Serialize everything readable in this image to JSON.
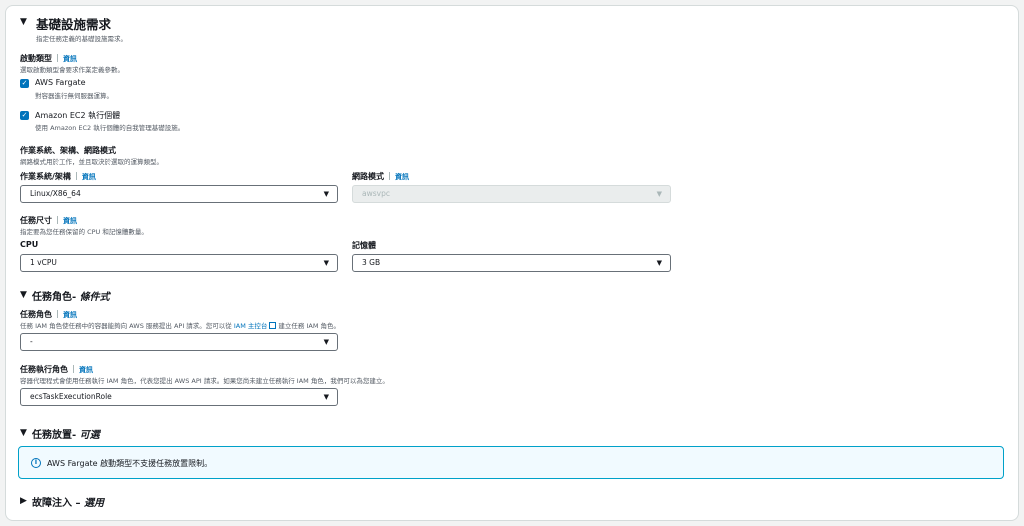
{
  "section": {
    "title": "基礎設施需求",
    "description": "指定任務定義的基礎設施需求。"
  },
  "launch_type": {
    "label": "啟動類型",
    "info": "資訊",
    "description": "選取啟動類型會要求作業定義參數。",
    "options": [
      {
        "title": "AWS Fargate",
        "description": "對容器進行無伺服器運算。",
        "checked": true
      },
      {
        "title": "Amazon EC2 執行個體",
        "description": "使用 Amazon EC2 執行個體的自我管理基礎設施。",
        "checked": true
      }
    ]
  },
  "os_arch_network": {
    "label": "作業系統、架構、網路模式",
    "description": "網路模式用於工作，並且取決於選取的運算類型。"
  },
  "os_arch": {
    "label": "作業系統/架構",
    "info": "資訊",
    "value": "Linux/X86_64"
  },
  "network_mode": {
    "label": "網路模式",
    "info": "資訊",
    "value": "awsvpc"
  },
  "task_size": {
    "label": "任務尺寸",
    "info": "資訊",
    "description": "指定要為您任務保留的 CPU 和記憶體數量。"
  },
  "cpu": {
    "label": "CPU",
    "value": "1 vCPU"
  },
  "memory": {
    "label": "記憶體",
    "value": "3 GB"
  },
  "task_role_section": {
    "title": "任務角色-",
    "suffix": "條件式"
  },
  "task_role": {
    "label": "任務角色",
    "info": "資訊",
    "description_pre": "任務 IAM 角色使任務中的容器能夠向 AWS 服務提出 API 請求。您可以從",
    "description_link": "IAM 主控台",
    "description_post": "建立任務 IAM 角色。",
    "value": "-"
  },
  "exec_role": {
    "label": "任務執行角色",
    "info": "資訊",
    "description": "容器代理程式會使用任務執行 IAM 角色，代表您提出 AWS API 請求。如果您尚未建立任務執行 IAM 角色，我們可以為您建立。",
    "value": "ecsTaskExecutionRole"
  },
  "placement_section": {
    "title": "任務放置-",
    "suffix": "可選"
  },
  "alert": {
    "text": "AWS Fargate 啟動類型不支援任務放置限制。"
  },
  "fault_section": {
    "title": "故障注入 –",
    "suffix": "選用"
  }
}
